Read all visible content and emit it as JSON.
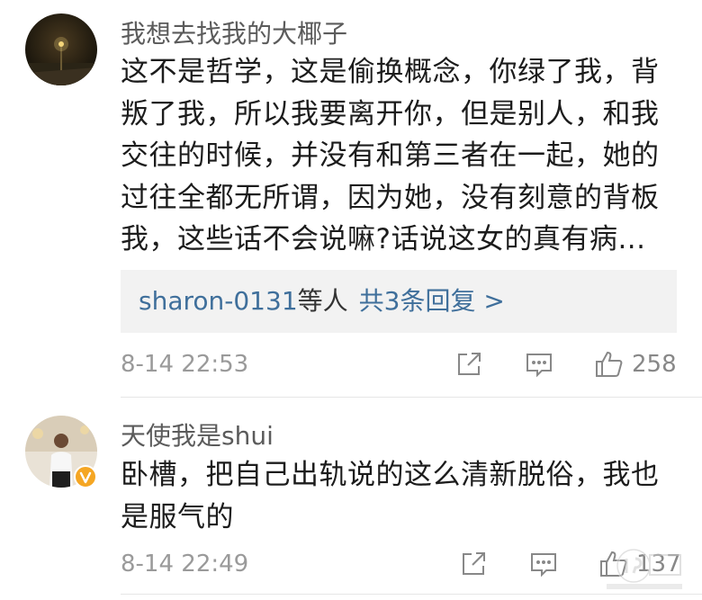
{
  "comments": [
    {
      "username": "我想去找我的大椰子",
      "text": "这不是哲学，这是偷换概念，你绿了我，背叛了我，所以我要离开你，但是别人，和我交往的时候，并没有和第三者在一起，她的过往全都无所谓，因为她，没有刻意的背板我，这些话不会说嘛?话说这女的真有病...",
      "replies": {
        "who": "sharon-0131",
        "suffix": "等人",
        "count_label": "共3条回复 >"
      },
      "time": "8-14 22:53",
      "likes": "258"
    },
    {
      "username": "天使我是shui",
      "text": "卧槽，把自己出轨说的这么清新脱俗，我也是服气的",
      "time": "8-14 22:49",
      "likes": "137"
    }
  ],
  "icons": {
    "share": "share-icon",
    "comment": "comment-icon",
    "like": "thumbs-up-icon",
    "verified": "verified-badge-icon"
  },
  "colors": {
    "link": "#3f6f9b",
    "meta": "#9a9a9a",
    "verified_badge": "#f5a623"
  }
}
